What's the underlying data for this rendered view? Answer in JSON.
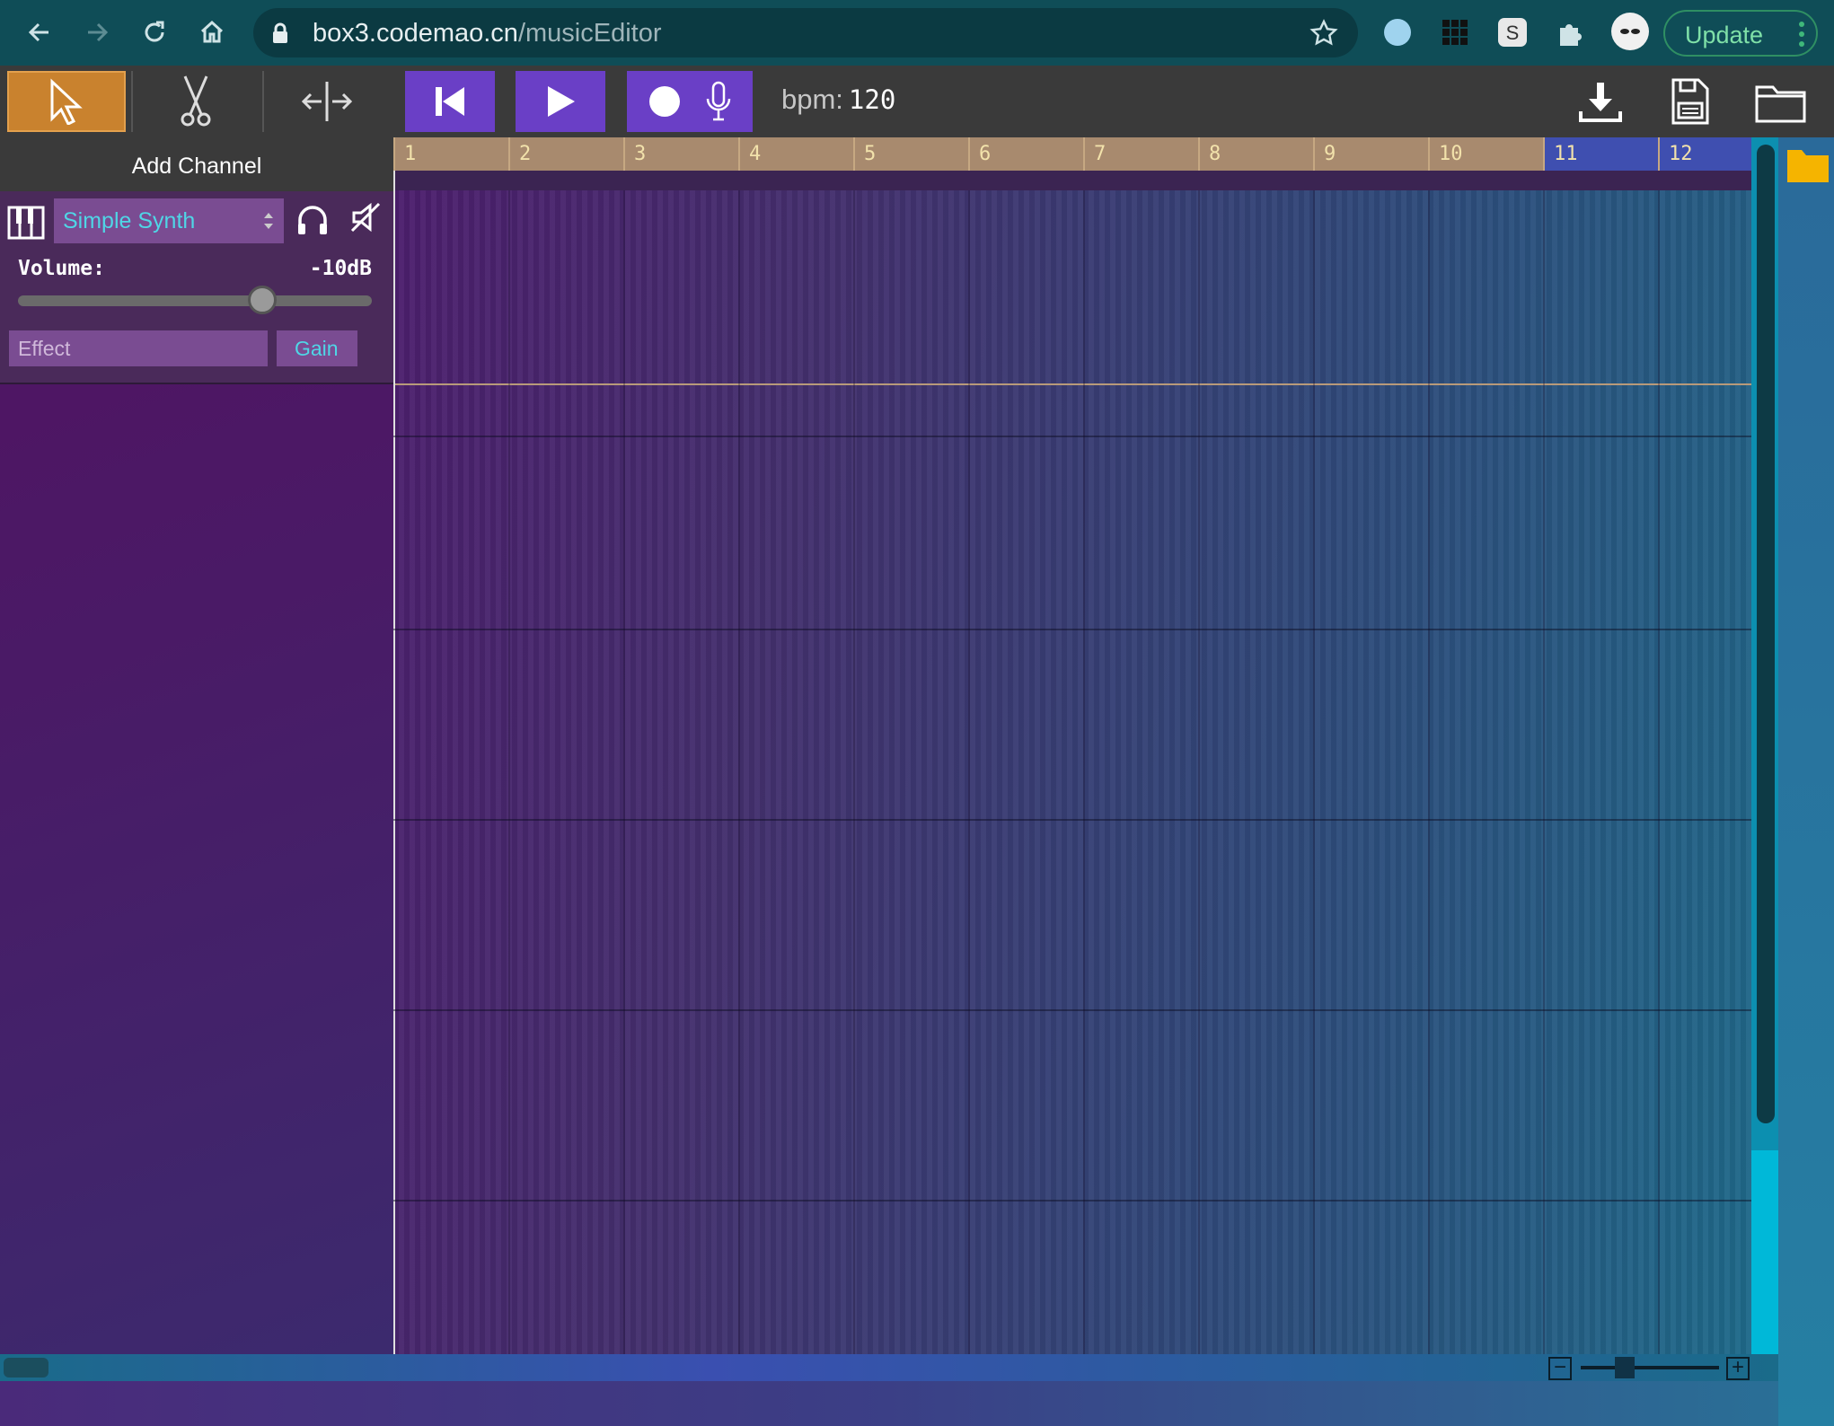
{
  "browser": {
    "url_host": "box3.codemao.cn",
    "url_path": "/musicEditor",
    "update_label": "Update"
  },
  "toolbar": {
    "bpm_label": "bpm:",
    "bpm_value": "120"
  },
  "sidebar": {
    "add_channel_label": "Add Channel",
    "channel": {
      "instrument": "Simple Synth",
      "volume_label": "Volume:",
      "volume_value": "-10dB",
      "volume_fraction": 0.69,
      "effect_placeholder": "Effect",
      "gain_label": "Gain"
    }
  },
  "timeline": {
    "bars": [
      "1",
      "2",
      "3",
      "4",
      "5",
      "6",
      "7",
      "8",
      "9",
      "10",
      "11",
      "12"
    ],
    "loop_start_bar": 11,
    "loop_end_bar": 12
  },
  "zoom": {
    "minus_label": "−",
    "plus_label": "+",
    "level_fraction": 0.32
  },
  "colors": {
    "accent_purple": "#6a3fc6",
    "select_tool": "#c9822e",
    "cyan_text": "#4fd6e6"
  }
}
